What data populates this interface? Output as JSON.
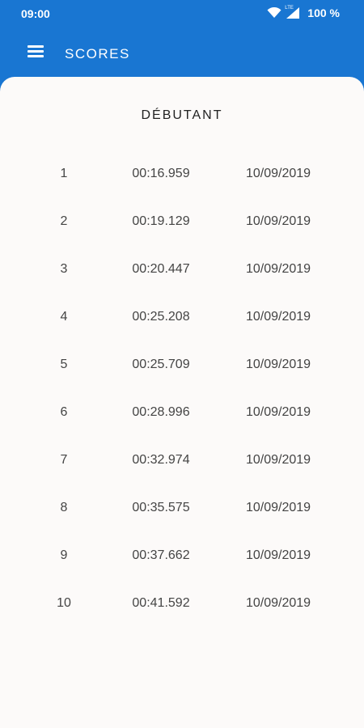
{
  "status_bar": {
    "time": "09:00",
    "network_label": "LTE",
    "battery": "100 %"
  },
  "app_bar": {
    "title": "SCORES",
    "menu_icon": "menu-icon"
  },
  "level": {
    "title": "DÉBUTANT"
  },
  "scores": [
    {
      "rank": "1",
      "time": "00:16.959",
      "date": "10/09/2019"
    },
    {
      "rank": "2",
      "time": "00:19.129",
      "date": "10/09/2019"
    },
    {
      "rank": "3",
      "time": "00:20.447",
      "date": "10/09/2019"
    },
    {
      "rank": "4",
      "time": "00:25.208",
      "date": "10/09/2019"
    },
    {
      "rank": "5",
      "time": "00:25.709",
      "date": "10/09/2019"
    },
    {
      "rank": "6",
      "time": "00:28.996",
      "date": "10/09/2019"
    },
    {
      "rank": "7",
      "time": "00:32.974",
      "date": "10/09/2019"
    },
    {
      "rank": "8",
      "time": "00:35.575",
      "date": "10/09/2019"
    },
    {
      "rank": "9",
      "time": "00:37.662",
      "date": "10/09/2019"
    },
    {
      "rank": "10",
      "time": "00:41.592",
      "date": "10/09/2019"
    }
  ],
  "colors": {
    "primary": "#1976d2",
    "card_background": "#fcfaf9",
    "text": "#444444"
  }
}
